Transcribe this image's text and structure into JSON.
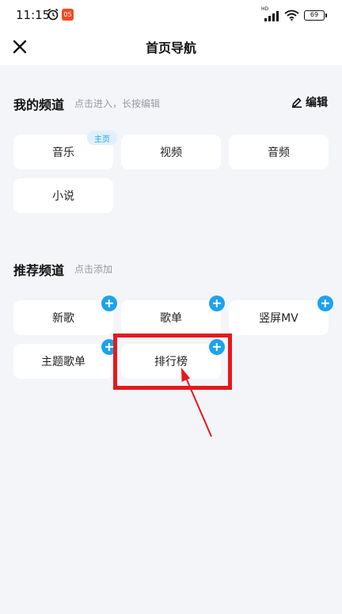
{
  "status_bar": {
    "time": "11:15",
    "app_badge": "05",
    "network": "HD",
    "battery": "69"
  },
  "header": {
    "title": "首页导航",
    "close_icon": "close-icon"
  },
  "my_channels": {
    "title": "我的频道",
    "hint": "点击进入，长按编辑",
    "edit_label": "编辑",
    "home_badge": "主页",
    "items": [
      "音乐",
      "视频",
      "音频",
      "小说"
    ]
  },
  "recommended_channels": {
    "title": "推荐频道",
    "hint": "点击添加",
    "items": [
      "新歌",
      "歌单",
      "竖屏MV",
      "主题歌单",
      "排行榜"
    ]
  },
  "colors": {
    "accent": "#1ba3f0",
    "highlight": "#e5191d",
    "background": "#f4f5f9"
  }
}
